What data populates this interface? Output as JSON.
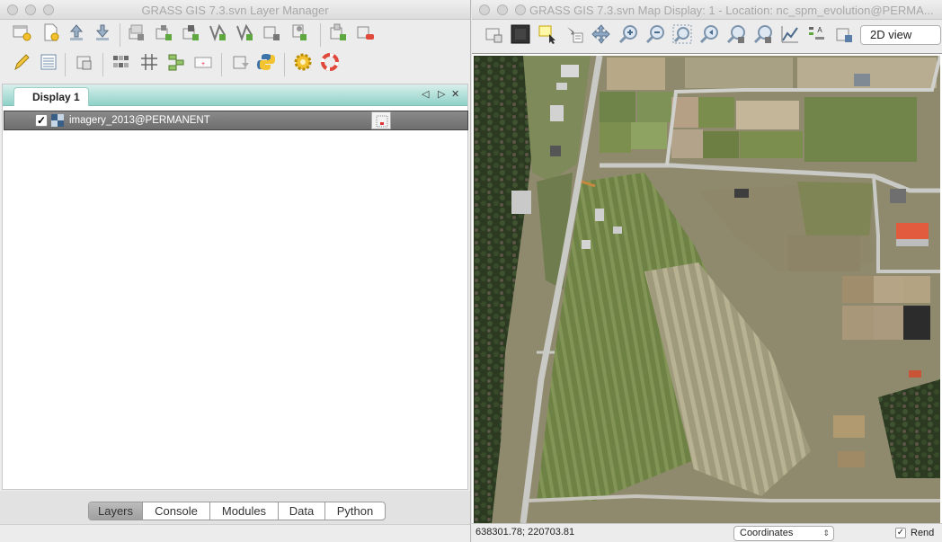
{
  "layer_manager": {
    "title": "GRASS GIS 7.3.svn Layer Manager",
    "notebook_tab": "Display 1",
    "layers": [
      {
        "name": "imagery_2013@PERMANENT",
        "checked": true
      }
    ],
    "bottom_tabs": [
      {
        "label": "Layers",
        "active": true
      },
      {
        "label": "Console",
        "active": false
      },
      {
        "label": "Modules",
        "active": false
      },
      {
        "label": "Data",
        "active": false
      },
      {
        "label": "Python",
        "active": false
      }
    ],
    "toolbar_row1_icons": [
      "new-display-icon",
      "new-workspace-icon",
      "open-workspace-icon",
      "save-workspace-icon",
      "add-raster-icon",
      "add-multiple-rasters-icon",
      "add-raster-misc-icon",
      "add-vector-icon",
      "add-multiple-vectors-icon",
      "add-vector-misc-icon",
      "add-overlay-icon",
      "add-group-icon",
      "remove-layer-icon"
    ],
    "toolbar_row2_icons": [
      "digitize-icon",
      "attribute-table-icon",
      "map-calculator-icon",
      "georectifier-icon",
      "grid-icon",
      "graphical-modeler-icon",
      "map-composer-icon",
      "script-icon",
      "python-icon",
      "settings-icon",
      "help-icon"
    ]
  },
  "map_display": {
    "title": "GRASS GIS 7.3.svn Map Display: 1 - Location: nc_spm_evolution@PERMA...",
    "view_mode": "2D view",
    "coordinates": "638301.78; 220703.81",
    "status_mode": "Coordinates",
    "render_label": "Rend",
    "render_checked": true,
    "toolbar_icons": [
      "display-icon",
      "erase-icon",
      "pointer-icon",
      "query-icon",
      "pan-icon",
      "zoom-in-icon",
      "zoom-out-icon",
      "zoom-extent-icon",
      "zoom-back-icon",
      "zoom-region-icon",
      "zoom-menu-icon",
      "analyze-icon",
      "decorations-icon",
      "save-image-icon"
    ]
  },
  "colors": {
    "tab_teal": "#8fd2c8",
    "selected_row": "#7a7a7a",
    "field_green": "#7d8f4f",
    "field_tan": "#b7aa88",
    "forest": "#2e3d22",
    "road": "#c9c9c5"
  }
}
